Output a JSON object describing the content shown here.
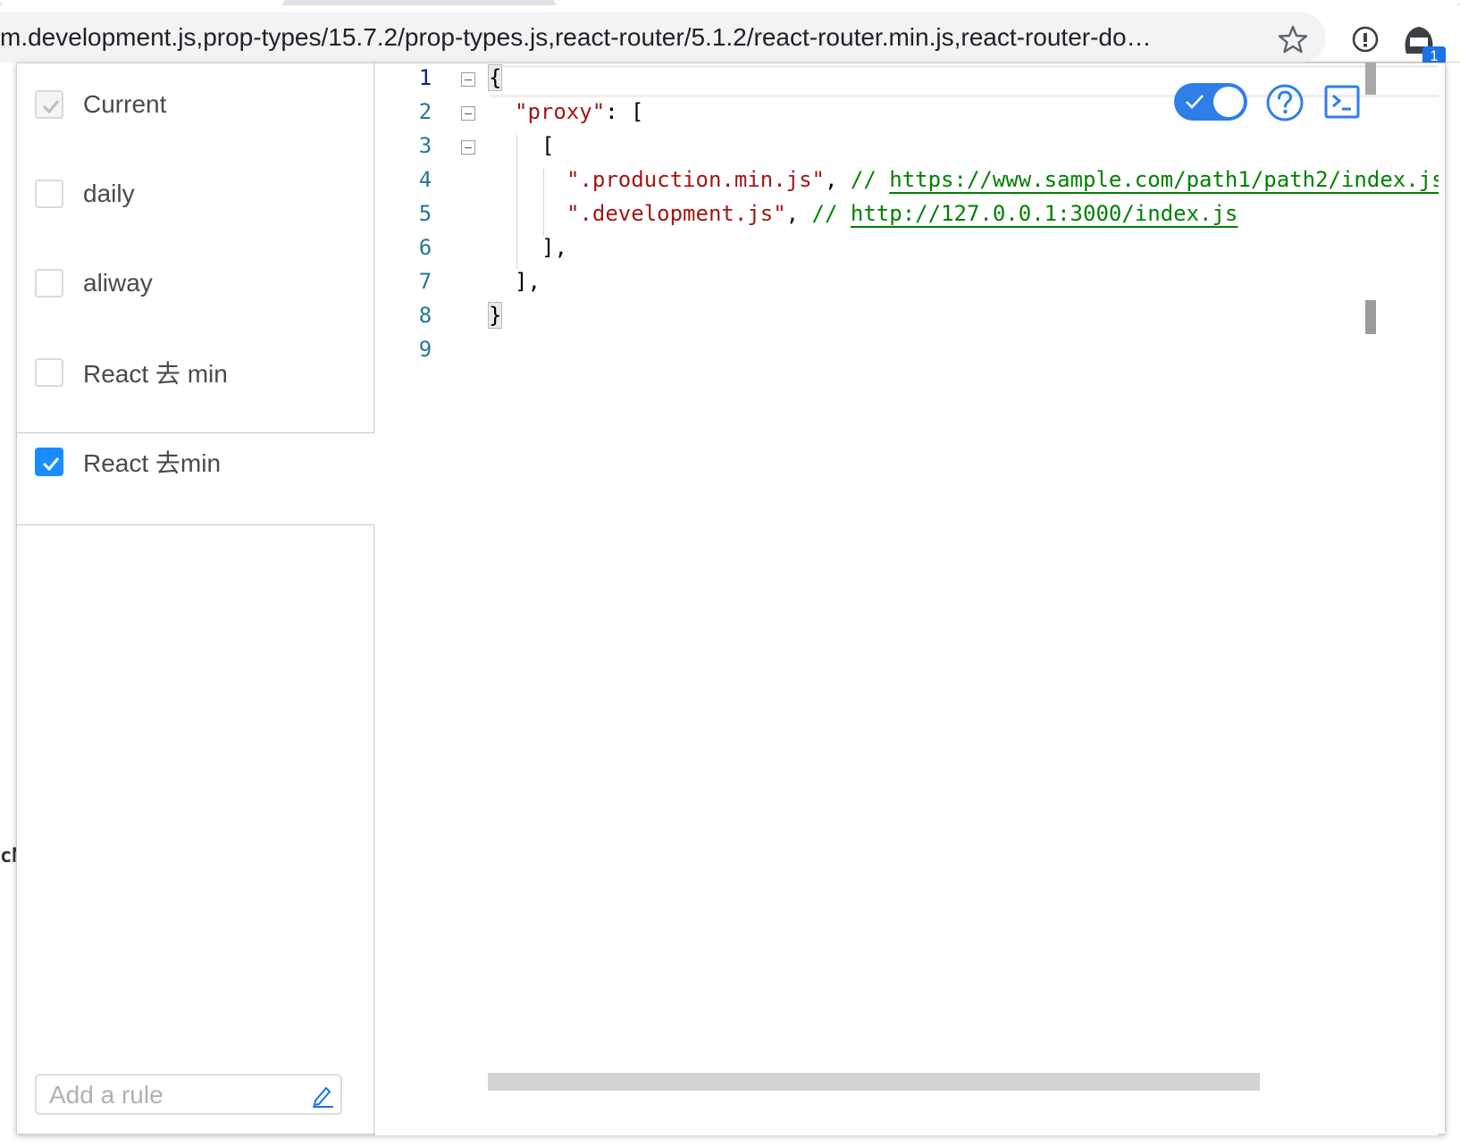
{
  "browser": {
    "url": "m.development.js,prop-types/15.7.2/prop-types.js,react-router/5.1.2/react-router.min.js,react-router-do…",
    "extension_badge": "1",
    "icons": [
      "star-icon",
      "info-icon",
      "extension-icon"
    ]
  },
  "sidebar": {
    "rules": [
      {
        "label": "Current",
        "checked": true,
        "disabled": true
      },
      {
        "label": "daily",
        "checked": false
      },
      {
        "label": "aliway",
        "checked": false
      },
      {
        "label": "React 去 min",
        "checked": false
      },
      {
        "label": "React 去min",
        "checked": true
      }
    ],
    "add_rule_placeholder": "Add a rule"
  },
  "editor": {
    "line_numbers": [
      "1",
      "2",
      "3",
      "4",
      "5",
      "6",
      "7",
      "8",
      "9"
    ],
    "lines": {
      "l1": "{",
      "l2_key": "\"proxy\"",
      "l2_rest": ": [",
      "l3": "[",
      "l4_str": "\".production.min.js\"",
      "l4_comma": ", ",
      "l4_cmt": "// ",
      "l4_link": "https://www.sample.com/path1/path2/index.js",
      "l5_str": "\".development.js\"",
      "l5_comma": ", ",
      "l5_cmt": "// ",
      "l5_link": "http://127.0.0.1:3000/index.js",
      "l6": "],",
      "l7": "],",
      "l8": "}"
    },
    "toggle_on": true
  },
  "left_edge_text": "cN",
  "colors": {
    "accent": "#1a8cff",
    "toggle": "#2f7ee8",
    "string": "#a31515",
    "comment": "#008000",
    "line_number": "#237893"
  }
}
